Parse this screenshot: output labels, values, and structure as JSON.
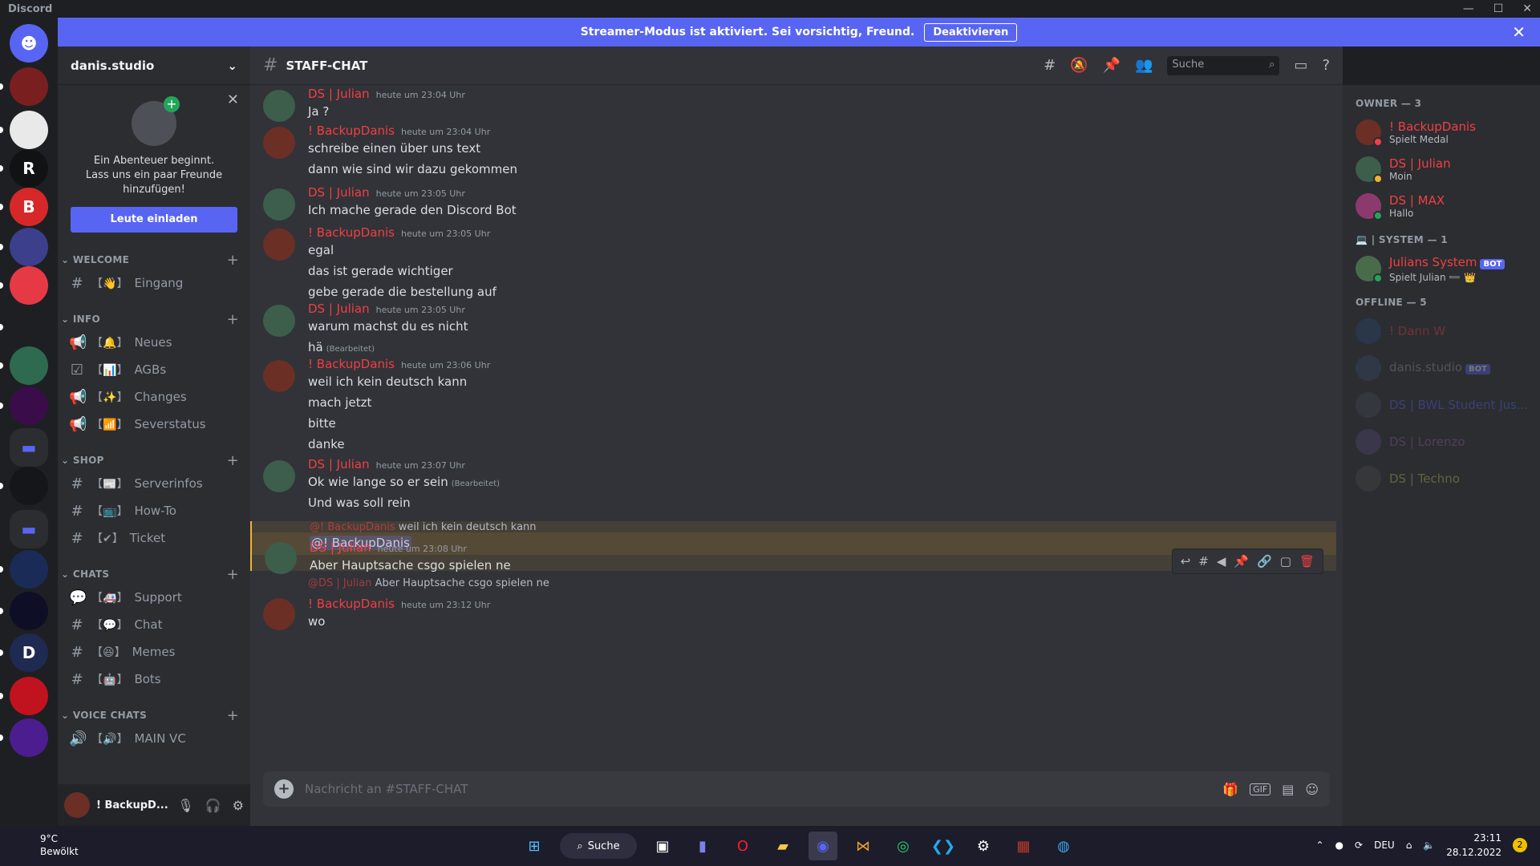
{
  "app_title": "Discord",
  "banner": {
    "text": "Streamer-Modus ist aktiviert. Sei vorsichtig, Freund.",
    "button": "Deaktivieren"
  },
  "servers": [
    {
      "label": "",
      "color": "#5865f2",
      "icon": "discord-home-icon"
    },
    {
      "label": "",
      "color": "#7a1f1f",
      "badge": "1"
    },
    {
      "label": "",
      "color": "#e9e9e9"
    },
    {
      "label": "R",
      "color": "#111214"
    },
    {
      "label": "B",
      "color": "#d62828"
    },
    {
      "label": "",
      "color": "#3b3f8c"
    },
    {
      "label": "",
      "color": "#e63946"
    },
    {
      "label": "",
      "color": "#1e1f22"
    },
    {
      "label": "",
      "color": "#2d6a4f"
    },
    {
      "label": "",
      "color": "#3a0d4a"
    },
    {
      "label": "",
      "color": "folder"
    },
    {
      "label": "",
      "color": "#14161a"
    },
    {
      "label": "",
      "color": "folder"
    },
    {
      "label": "",
      "color": "#1b2b57"
    },
    {
      "label": "",
      "color": "#0e0e26"
    },
    {
      "label": "D",
      "color": "#1e2a52"
    },
    {
      "label": "",
      "color": "#c1121f"
    },
    {
      "label": "",
      "color": "#4b1d8f"
    }
  ],
  "guild": {
    "name": "danis.studio"
  },
  "invite": {
    "text1": "Ein Abenteuer beginnt.",
    "text2": "Lass uns ein paar Freunde",
    "text3": "hinzufügen!",
    "button": "Leute einladen"
  },
  "categories": [
    {
      "name": "WELCOME",
      "channels": [
        {
          "icon": "#",
          "emoji": "👋",
          "name": "Eingang"
        }
      ]
    },
    {
      "name": "INFO",
      "channels": [
        {
          "icon": "📢",
          "emoji": "🔔",
          "name": "Neues"
        },
        {
          "icon": "☑",
          "emoji": "📊",
          "name": "AGBs"
        },
        {
          "icon": "📢",
          "emoji": "✨",
          "name": "Changes"
        },
        {
          "icon": "📢",
          "emoji": "📶",
          "name": "Severstatus"
        }
      ]
    },
    {
      "name": "SHOP",
      "channels": [
        {
          "icon": "#",
          "emoji": "📰",
          "name": "Serverinfos"
        },
        {
          "icon": "#",
          "emoji": "📺",
          "name": "How-To"
        },
        {
          "icon": "#",
          "emoji": "✔",
          "name": "Ticket"
        }
      ]
    },
    {
      "name": "CHATS",
      "channels": [
        {
          "icon": "💬",
          "emoji": "🚑",
          "name": "Support"
        },
        {
          "icon": "#",
          "emoji": "💬",
          "name": "Chat"
        },
        {
          "icon": "#",
          "emoji": "😆",
          "name": "Memes"
        },
        {
          "icon": "#",
          "emoji": "🤖",
          "name": "Bots"
        }
      ]
    },
    {
      "name": "VOICE CHATS",
      "channels": [
        {
          "icon": "🔊",
          "emoji": "🔊",
          "name": "MAIN VC"
        }
      ]
    }
  ],
  "user": {
    "name": "! BackupD..."
  },
  "channel": {
    "name": "STAFF-CHAT",
    "search_placeholder": "Suche"
  },
  "messages": [
    {
      "author": "DS | Julian",
      "time": "heute um 23:04 Uhr",
      "lines": [
        "Ja ?"
      ]
    },
    {
      "author": "! BackupDanis",
      "time": "heute um 23:04 Uhr",
      "lines": [
        "schreibe einen über uns text",
        "dann wie sind wir dazu gekommen"
      ]
    },
    {
      "author": "DS | Julian",
      "time": "heute um 23:05 Uhr",
      "lines": [
        "Ich mache gerade den Discord Bot"
      ]
    },
    {
      "author": "! BackupDanis",
      "time": "heute um 23:05 Uhr",
      "lines": [
        "egal",
        "das ist gerade wichtiger",
        "gebe gerade die bestellung auf"
      ]
    },
    {
      "author": "DS | Julian",
      "time": "heute um 23:05 Uhr",
      "lines": [
        "warum machst du es nicht",
        "hä"
      ],
      "edited": "(Bearbeitet)"
    },
    {
      "author": "! BackupDanis",
      "time": "heute um 23:06 Uhr",
      "lines": [
        "weil ich kein deutsch kann",
        "mach jetzt",
        "bitte",
        "danke"
      ]
    },
    {
      "author": "DS | Julian",
      "time": "heute um 23:07 Uhr",
      "lines": [
        "Ok wie lange so er sein",
        "Und was soll rein"
      ],
      "edited": "(Bearbeitet)",
      "mention": "@! BackupDanis"
    },
    {
      "author": "DS | Julian",
      "time": "heute um 23:08 Uhr",
      "lines": [
        "Aber Hauptsache csgo spielen ne"
      ],
      "reply_author": "@! BackupDanis",
      "reply_text": "weil ich kein deutsch kann"
    },
    {
      "author": "! BackupDanis",
      "time": "heute um 23:12 Uhr",
      "lines": [
        "wo"
      ],
      "reply_author": "@DS | Julian",
      "reply_text": "Aber Hauptsache csgo spielen ne"
    }
  ],
  "composer": {
    "placeholder": "Nachricht an #STAFF-CHAT",
    "gif": "GIF"
  },
  "members": {
    "groups": [
      {
        "title": "OWNER — 3",
        "items": [
          {
            "name": "! BackupDanis",
            "activity": "Spielt Medal",
            "color": "#f23f43",
            "status": "#f23f43"
          },
          {
            "name": "DS | Julian",
            "activity": "Moin",
            "color": "#f23f43",
            "status": "#f0b232"
          },
          {
            "name": "DS | MAX",
            "activity": "Hallo",
            "color": "#f23f43",
            "status": "#23a559"
          }
        ]
      },
      {
        "title": "💻 | SYSTEM — 1",
        "items": [
          {
            "name": "Julians System",
            "activity": "Spielt Julian ➖ 👑",
            "color": "#f23f43",
            "status": "#23a559",
            "bot": "BOT"
          }
        ]
      },
      {
        "title": "OFFLINE — 5",
        "offline": true,
        "items": [
          {
            "name": "! Dann W",
            "activity": "",
            "color": "#f23f43"
          },
          {
            "name": "danis.studio",
            "activity": "",
            "color": "#949ba4",
            "bot": "BOT"
          },
          {
            "name": "DS | BWL Student Jus...",
            "activity": "",
            "color": "#5865f2"
          },
          {
            "name": "DS | Lorenzo",
            "activity": "",
            "color": "#9b59b6"
          },
          {
            "name": "DS | Techno",
            "activity": "",
            "color": "#c9c94b"
          }
        ]
      }
    ]
  },
  "taskbar": {
    "temp": "9°C",
    "weather": "Bewölkt",
    "search": "Suche",
    "lang": "DEU",
    "time": "23:11",
    "date": "28.12.2022",
    "notif": "2"
  }
}
